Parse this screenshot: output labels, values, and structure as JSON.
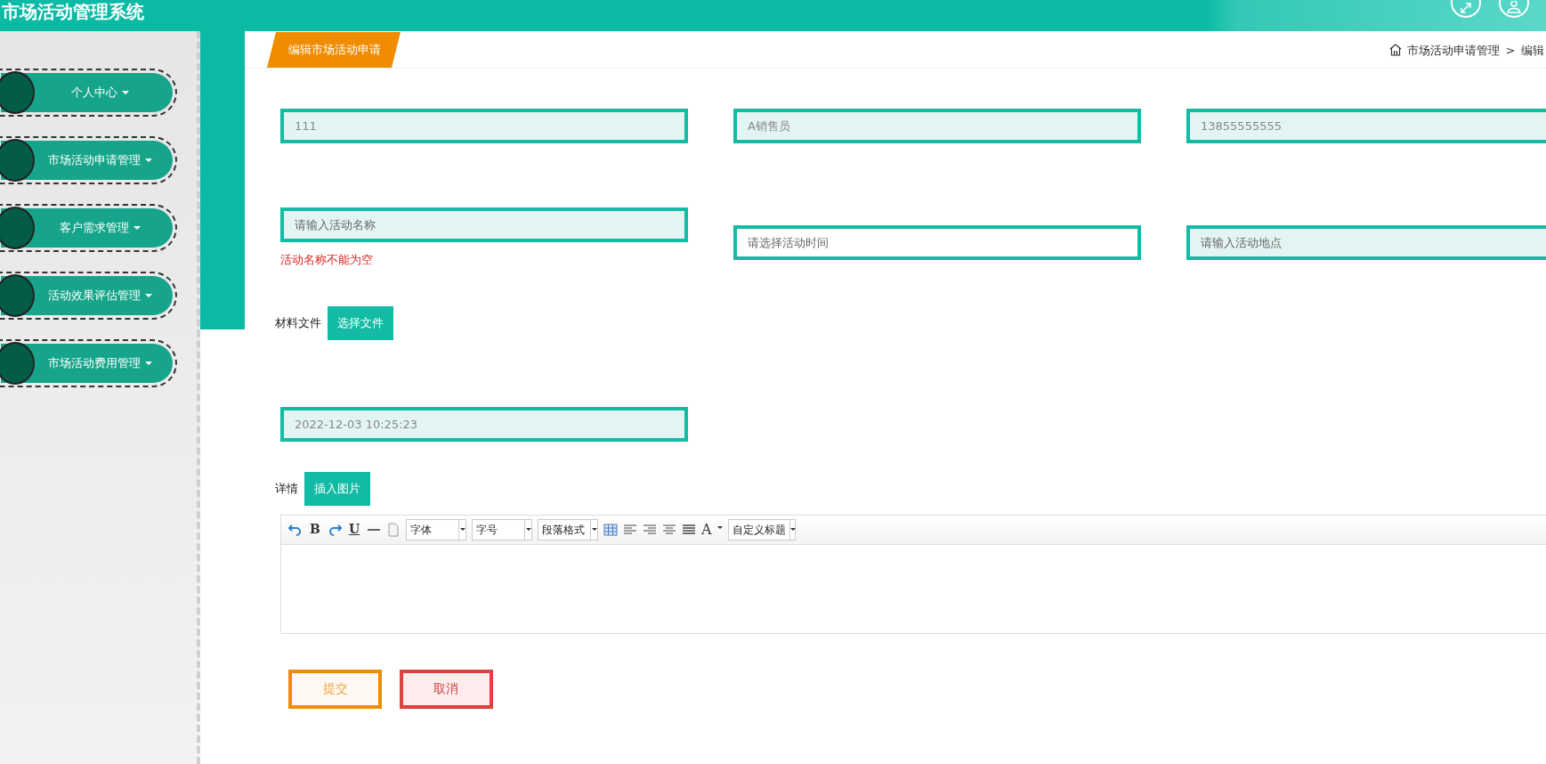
{
  "header": {
    "title": "市场活动管理系统"
  },
  "sidebar": {
    "items": [
      {
        "label": "个人中心"
      },
      {
        "label": "市场活动申请管理"
      },
      {
        "label": "客户需求管理"
      },
      {
        "label": "活动效果评估管理"
      },
      {
        "label": "市场活动费用管理"
      }
    ]
  },
  "tab": {
    "label": "编辑市场活动申请"
  },
  "breadcrumb": [
    "市场活动申请管理",
    "编辑"
  ],
  "breadcrumb_separator": ">",
  "form": {
    "rows": [
      [
        {
          "kind": "text",
          "value": "111"
        },
        {
          "kind": "text",
          "value": "A销售员"
        },
        {
          "kind": "text",
          "value": "13855555555"
        }
      ],
      [
        {
          "kind": "text",
          "placeholder": "请输入活动名称",
          "error": "活动名称不能为空"
        },
        {
          "kind": "picker",
          "placeholder": "请选择活动时间"
        },
        {
          "kind": "text",
          "placeholder": "请输入活动地点"
        }
      ]
    ],
    "file": {
      "label": "材料文件",
      "button": "选择文件"
    },
    "date": {
      "value": "2022-12-03 10:25:23"
    },
    "details": {
      "label": "详情",
      "button": "插入图片"
    },
    "toolbar": [
      {
        "kind": "undo"
      },
      {
        "kind": "bold",
        "label": "B"
      },
      {
        "kind": "redo"
      },
      {
        "kind": "underline",
        "label": "U"
      },
      {
        "kind": "rule"
      },
      {
        "kind": "page"
      },
      {
        "kind": "select",
        "label": "字体"
      },
      {
        "kind": "select",
        "label": "字号"
      },
      {
        "kind": "select",
        "label": "段落格式"
      },
      {
        "kind": "table"
      },
      {
        "kind": "align-left"
      },
      {
        "kind": "align-right"
      },
      {
        "kind": "align-center"
      },
      {
        "kind": "justify"
      },
      {
        "kind": "font-color",
        "label": "A"
      },
      {
        "kind": "select",
        "label": "自定义标题"
      }
    ],
    "buttons": [
      {
        "kind": "submit",
        "label": "提交"
      },
      {
        "kind": "cancel",
        "label": "取消"
      }
    ]
  }
}
